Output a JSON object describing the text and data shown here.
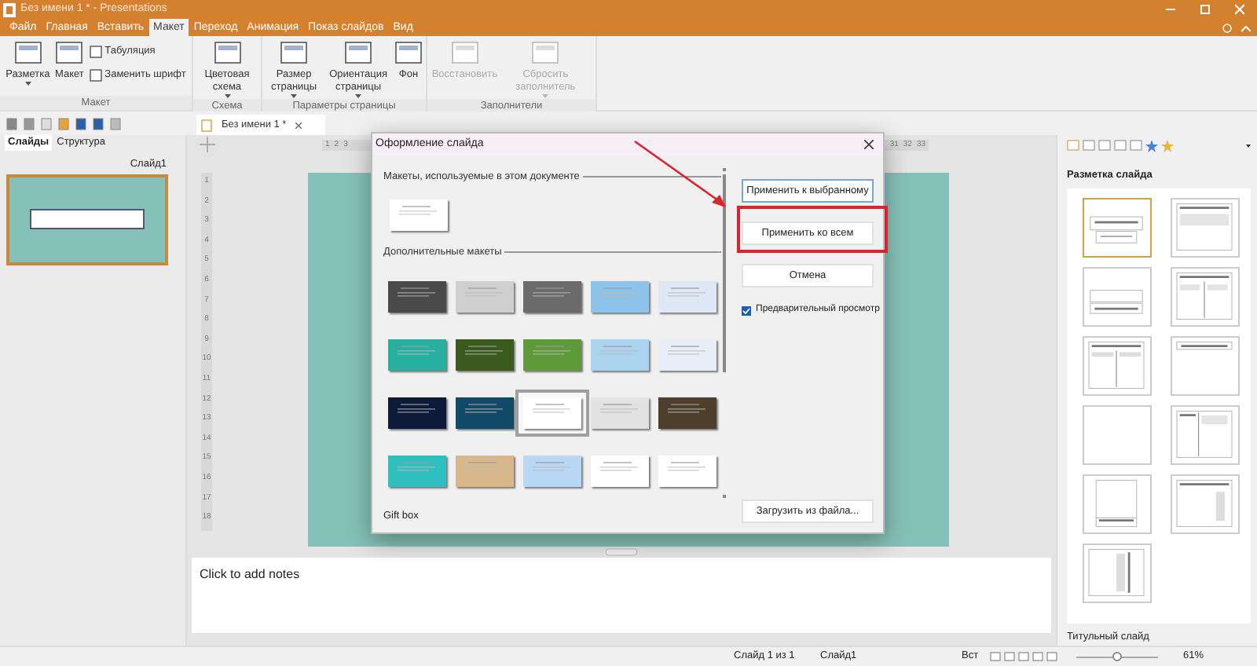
{
  "window": {
    "title": "Без имени 1 * - Presentations"
  },
  "menu_tabs": [
    {
      "label": "Файл",
      "selected": false
    },
    {
      "label": "Главная",
      "selected": false
    },
    {
      "label": "Вставить",
      "selected": false
    },
    {
      "label": "Макет",
      "selected": true
    },
    {
      "label": "Переход",
      "selected": false
    },
    {
      "label": "Анимация",
      "selected": false
    },
    {
      "label": "Показ слайдов",
      "selected": false
    },
    {
      "label": "Вид",
      "selected": false
    }
  ],
  "ribbon_groups": [
    {
      "label": "Макет",
      "buttons": [
        {
          "kind": "large",
          "label": "Разметка",
          "dropdown": true,
          "disabled": false
        },
        {
          "kind": "large",
          "label": "Макет",
          "dropdown": false,
          "disabled": false
        },
        {
          "kind": "small",
          "label": "Табуляция",
          "disabled": false
        },
        {
          "kind": "small",
          "label": "Заменить шрифт",
          "disabled": false
        }
      ]
    },
    {
      "label": "Схема",
      "buttons": [
        {
          "kind": "large",
          "label": "Цветовая схема",
          "dropdown": true,
          "disabled": false
        }
      ]
    },
    {
      "label": "Параметры страницы",
      "buttons": [
        {
          "kind": "large",
          "label": "Размер страницы",
          "dropdown": true,
          "disabled": false
        },
        {
          "kind": "large",
          "label": "Ориентация страницы",
          "dropdown": true,
          "disabled": false
        },
        {
          "kind": "large",
          "label": "Фон",
          "dropdown": false,
          "disabled": false
        }
      ]
    },
    {
      "label": "Заполнители",
      "buttons": [
        {
          "kind": "large",
          "label": "Восстановить",
          "dropdown": false,
          "disabled": true
        },
        {
          "kind": "large",
          "label": "Сбросить заполнитель",
          "dropdown": true,
          "disabled": true
        }
      ]
    }
  ],
  "document_tab": {
    "title": "Без имени 1 *"
  },
  "slides_panel": {
    "tabs": [
      {
        "label": "Слайды",
        "selected": true
      },
      {
        "label": "Структура",
        "selected": false
      }
    ],
    "slides": [
      {
        "label": "Слайд1",
        "selected": true
      }
    ]
  },
  "ruler": {
    "top_labels": [
      "1",
      "2",
      "3",
      "31",
      "32",
      "33"
    ],
    "left_labels": [
      "1",
      "2",
      "3",
      "4",
      "5",
      "6",
      "7",
      "8",
      "9",
      "10",
      "11",
      "12",
      "13",
      "14",
      "15",
      "16",
      "17",
      "18"
    ]
  },
  "notes": {
    "placeholder": "Click to add notes"
  },
  "dialog": {
    "title": "Оформление слайда",
    "used_heading": "Макеты, используемые в этом документе",
    "used_templates": [
      {
        "color": "#ffffff",
        "selected": false
      }
    ],
    "more_heading": "Дополнительные макеты",
    "templates": [
      {
        "color": "#4a4a4a",
        "selected": false
      },
      {
        "color": "#cfcfcf",
        "selected": false
      },
      {
        "color": "#6b6b6b",
        "selected": false
      },
      {
        "color": "#8fc4ea",
        "selected": false
      },
      {
        "color": "#dfe8f5",
        "selected": false
      },
      {
        "color": "#27b0a0",
        "selected": false
      },
      {
        "color": "#3b5a1d",
        "selected": false
      },
      {
        "color": "#5f9a3a",
        "selected": false
      },
      {
        "color": "#a9d3ef",
        "selected": false
      },
      {
        "color": "#e8eef7",
        "selected": false
      },
      {
        "color": "#0d1a3a",
        "selected": false
      },
      {
        "color": "#0f4a66",
        "selected": false
      },
      {
        "color": "#ffffff",
        "selected": true
      },
      {
        "color": "#e2e2e2",
        "selected": false
      },
      {
        "color": "#4e3f2c",
        "selected": false
      },
      {
        "color": "#2fbfbf",
        "selected": false
      },
      {
        "color": "#d8b88a",
        "selected": false
      },
      {
        "color": "#b8d8f5",
        "selected": false
      },
      {
        "color": "#ffffff",
        "selected": false
      },
      {
        "color": "#ffffff",
        "selected": false
      }
    ],
    "selected_name": "Gift box",
    "buttons": [
      {
        "label": "Применить к выбранному",
        "highlighted": false
      },
      {
        "label": "Применить ко всем",
        "highlighted": true
      },
      {
        "label": "Отмена",
        "highlighted": false
      }
    ],
    "preview": {
      "label": "Предварительный просмотр",
      "checked": true
    },
    "load_button": "Загрузить из файла..."
  },
  "layout_panel": {
    "title": "Разметка слайда",
    "layouts": [
      {
        "kind": "title",
        "selected": true
      },
      {
        "kind": "title-content",
        "selected": false
      },
      {
        "kind": "section",
        "selected": false
      },
      {
        "kind": "two-content",
        "selected": false
      },
      {
        "kind": "comparison",
        "selected": false
      },
      {
        "kind": "title-only",
        "selected": false
      },
      {
        "kind": "blank",
        "selected": false
      },
      {
        "kind": "content-caption",
        "selected": false
      },
      {
        "kind": "picture-caption",
        "selected": false
      },
      {
        "kind": "title-vertical",
        "selected": false
      },
      {
        "kind": "vertical-title",
        "selected": false
      }
    ],
    "caption": "Титульный слайд"
  },
  "status_bar": {
    "slide": "Слайд 1 из 1",
    "slide_name": "Слайд1",
    "mode": "Вст",
    "zoom": {
      "level": 0.5,
      "reading": "61%"
    }
  }
}
